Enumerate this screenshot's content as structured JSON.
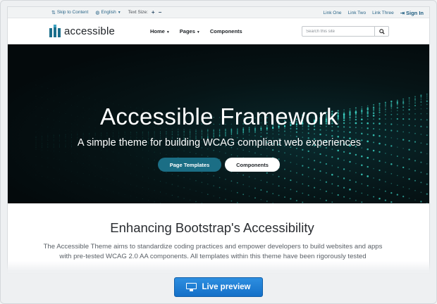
{
  "utility": {
    "skip_link": "Skip to Content",
    "language": "English",
    "text_size_label": "Text Size:",
    "text_size_increase": "+",
    "text_size_decrease": "−",
    "links": [
      "Link One",
      "Link Two",
      "Link Three"
    ],
    "sign_in": "Sign In"
  },
  "brand": {
    "name": "accessible"
  },
  "nav": {
    "items": [
      {
        "label": "Home",
        "dropdown": true
      },
      {
        "label": "Pages",
        "dropdown": true
      },
      {
        "label": "Components",
        "dropdown": false
      }
    ],
    "search_placeholder": "Search this site"
  },
  "hero": {
    "title": "Accessible Framework",
    "subtitle": "A simple theme for building WCAG compliant web experiences",
    "primary_button": "Page Templates",
    "secondary_button": "Components"
  },
  "content": {
    "heading": "Enhancing Bootstrap's Accessibility",
    "paragraph": "The Accessible Theme aims to standardize coding practices and empower developers to build websites and apps with pre-tested WCAG 2.0 AA components. All templates within this theme have been rigorously tested"
  },
  "overlay": {
    "live_preview": "Live preview"
  },
  "colors": {
    "accent": "#1b6e85",
    "link": "#2b6688",
    "hero_bg": "#061416",
    "live_button": "#1f7fd6"
  }
}
